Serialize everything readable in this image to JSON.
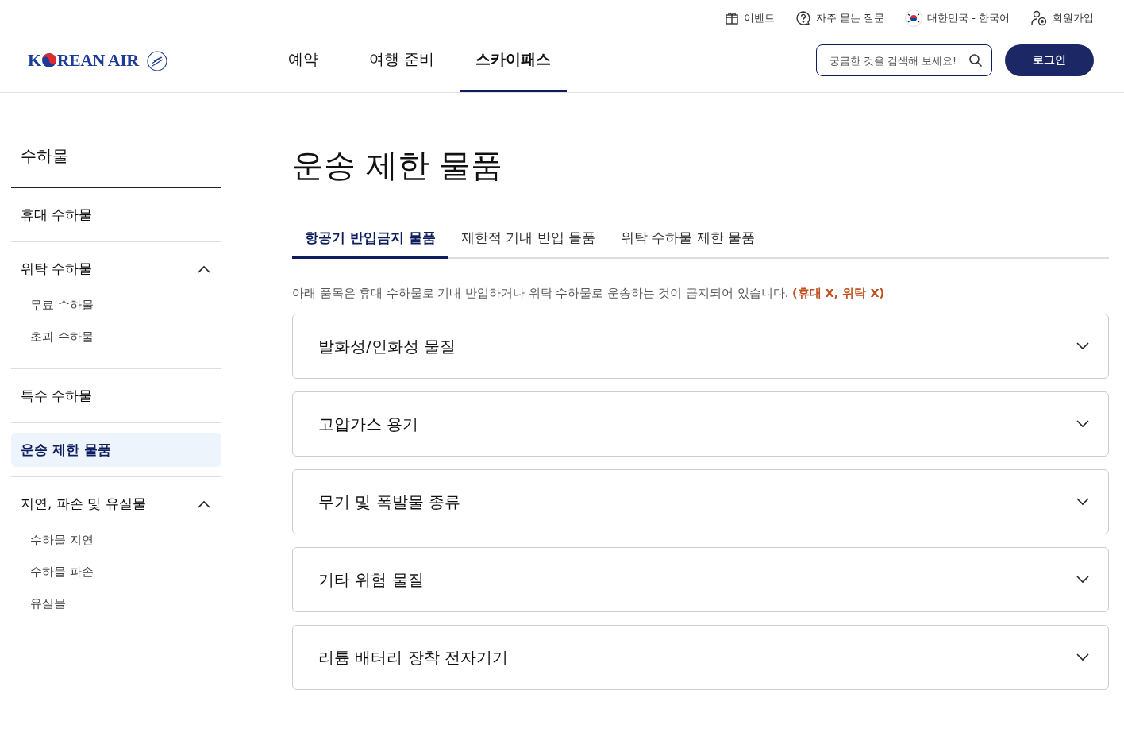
{
  "utility_links": [
    {
      "kind": "gift",
      "label": "이벤트"
    },
    {
      "kind": "help",
      "label": "자주 묻는 질문"
    },
    {
      "kind": "flag",
      "label": "대한민국 - 한국어"
    },
    {
      "kind": "signup",
      "label": "회원가입"
    }
  ],
  "logo": {
    "before": "K",
    "after": "REAN AIR"
  },
  "nav": [
    {
      "label": "예약",
      "selected": false
    },
    {
      "label": "여행 준비",
      "selected": false
    },
    {
      "label": "스카이패스",
      "selected": true
    }
  ],
  "search": {
    "placeholder": "궁금한 것을 검색해 보세요!"
  },
  "login_button": "로그인",
  "sidebar": {
    "title": "수하물",
    "items": [
      {
        "label": "휴대 수하물",
        "selected": false
      },
      {
        "label": "위탁 수하물",
        "selected": false,
        "expanded": true,
        "children": [
          {
            "label": "무료 수하물"
          },
          {
            "label": "초과 수하물"
          }
        ]
      },
      {
        "label": "특수 수하물",
        "selected": false
      },
      {
        "label": "운송 제한 물품",
        "selected": true
      },
      {
        "label": "지연, 파손 및 유실물",
        "selected": false,
        "expanded": true,
        "children": [
          {
            "label": "수하물 지연"
          },
          {
            "label": "수하물 파손"
          },
          {
            "label": "유실물"
          }
        ]
      }
    ]
  },
  "page_title": "운송 제한 물품",
  "tabs": [
    {
      "label": "항공기 반입금지 물품",
      "selected": true
    },
    {
      "label": "제한적 기내 반입 물품",
      "selected": false
    },
    {
      "label": "위탁 수하물 제한 물품",
      "selected": false
    }
  ],
  "notice": "아래 품목은 휴대 수하물로 기내 반입하거나 위탁 수하물로 운송하는 것이 금지되어 있습니다. **(휴대 X, 위탁 X)**",
  "accordion": [
    {
      "title": "발화성/인화성 물질",
      "expanded": false
    },
    {
      "title": "고압가스 용기",
      "expanded": false
    },
    {
      "title": "무기 및 폭발물 종류",
      "expanded": false
    },
    {
      "title": "기타 위험 물질",
      "expanded": false
    },
    {
      "title": "리튬 배터리 장착 전자기기",
      "expanded": false
    }
  ]
}
